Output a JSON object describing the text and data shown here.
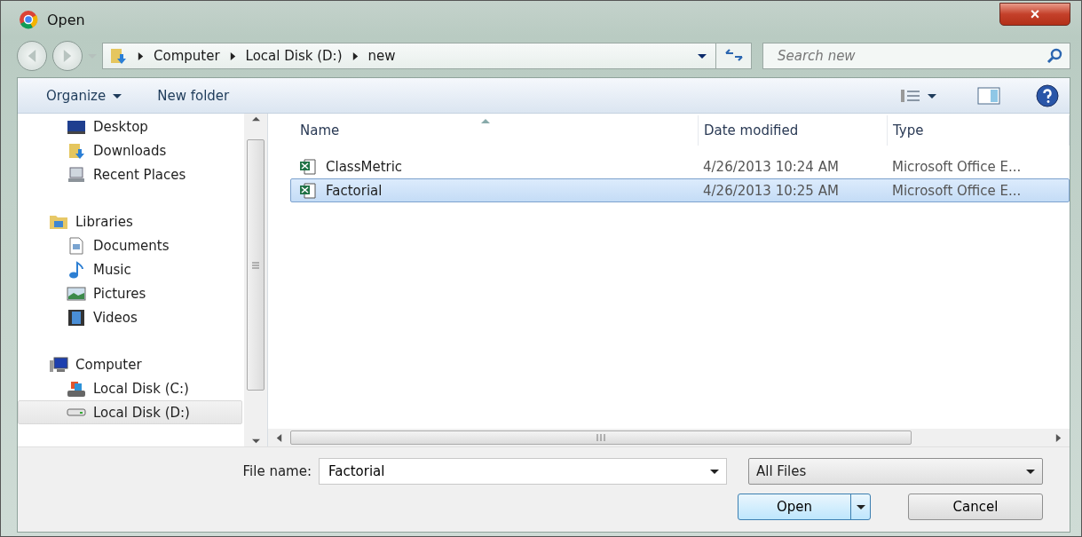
{
  "window": {
    "title": "Open",
    "close_label": "×"
  },
  "address": {
    "crumbs": [
      "Computer",
      "Local Disk (D:)",
      "new"
    ]
  },
  "search": {
    "placeholder": "Search new"
  },
  "toolbar": {
    "organize": "Organize",
    "new_folder": "New folder"
  },
  "nav_sections": [
    {
      "items": [
        {
          "label": "Desktop",
          "kind": "desktop",
          "selected": false
        },
        {
          "label": "Downloads",
          "kind": "downloads",
          "selected": false
        },
        {
          "label": "Recent Places",
          "kind": "recent",
          "selected": false
        }
      ]
    },
    {
      "label": "Libraries",
      "kind": "library",
      "selected": false,
      "items": [
        {
          "label": "Documents",
          "kind": "documents",
          "selected": false
        },
        {
          "label": "Music",
          "kind": "music",
          "selected": false
        },
        {
          "label": "Pictures",
          "kind": "pictures",
          "selected": false
        },
        {
          "label": "Videos",
          "kind": "videos",
          "selected": false
        }
      ]
    },
    {
      "label": "Computer",
      "kind": "computer",
      "selected": false,
      "items": [
        {
          "label": "Local Disk (C:)",
          "kind": "system-drive",
          "selected": false
        },
        {
          "label": "Local Disk (D:)",
          "kind": "drive",
          "selected": true
        }
      ]
    }
  ],
  "table": {
    "columns": [
      "Name",
      "Date modified",
      "Type"
    ],
    "rows": [
      {
        "name": "ClassMetric",
        "date": "4/26/2013 10:24 AM",
        "type": "Microsoft Office E...",
        "selected": false
      },
      {
        "name": "Factorial",
        "date": "4/26/2013 10:25 AM",
        "type": "Microsoft Office E...",
        "selected": true
      }
    ]
  },
  "file_name": {
    "label": "File name:",
    "value": "Factorial"
  },
  "file_type": {
    "value": "All Files"
  },
  "buttons": {
    "open": "Open",
    "cancel": "Cancel"
  }
}
